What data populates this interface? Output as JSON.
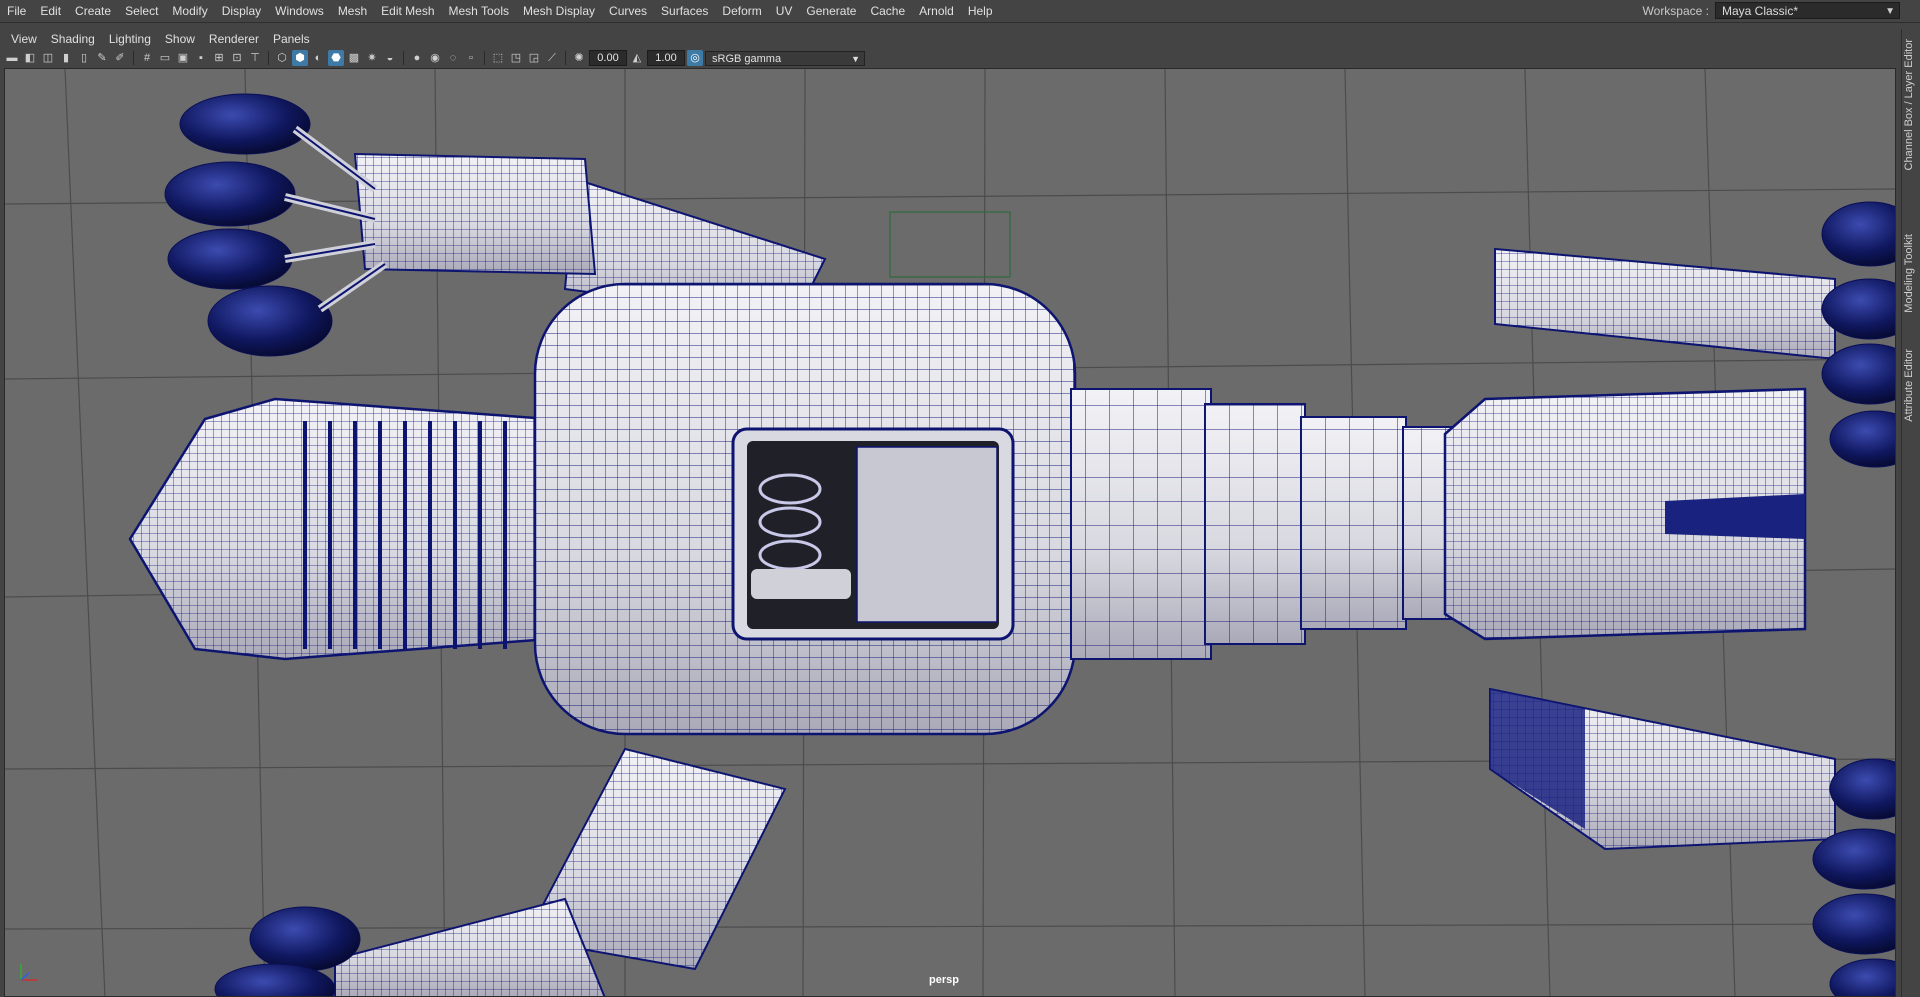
{
  "menubar": {
    "items": [
      "File",
      "Edit",
      "Create",
      "Select",
      "Modify",
      "Display",
      "Windows",
      "Mesh",
      "Edit Mesh",
      "Mesh Tools",
      "Mesh Display",
      "Curves",
      "Surfaces",
      "Deform",
      "UV",
      "Generate",
      "Cache",
      "Arnold",
      "Help"
    ]
  },
  "workspace": {
    "label": "Workspace :",
    "value": "Maya Classic*"
  },
  "panel_menu": {
    "items": [
      "View",
      "Shading",
      "Lighting",
      "Show",
      "Renderer",
      "Panels"
    ]
  },
  "toolbar": {
    "exposure_value": "0.00",
    "gamma_value": "1.00",
    "color_space": "sRGB gamma"
  },
  "viewport": {
    "camera_label": "persp"
  },
  "side_tabs": [
    "Channel Box / Layer Editor",
    "Modeling Toolkit",
    "Attribute Editor"
  ],
  "colors": {
    "viewport_bg": "#6b6b6b",
    "wire": "#0d1470",
    "surface": "#e6e6ec",
    "accent": "#3d7aa6"
  }
}
